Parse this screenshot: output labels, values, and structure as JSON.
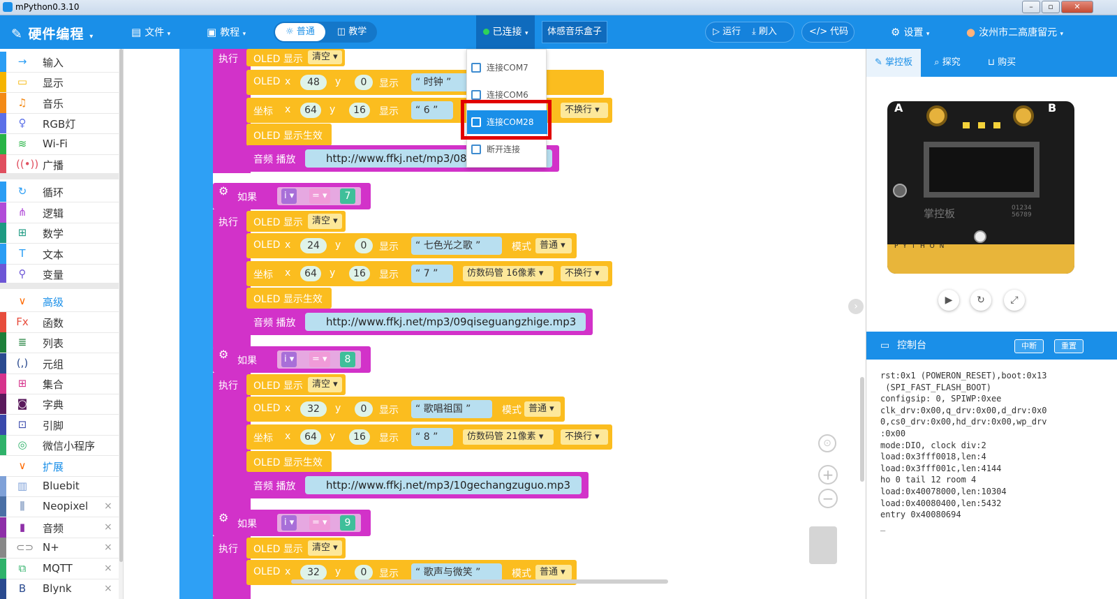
{
  "window": {
    "title": "mPython0.3.10"
  },
  "nav": {
    "logo": "硬件编程",
    "file": "文件",
    "tutorial": "教程",
    "mode_normal": "普通",
    "mode_teach": "教学",
    "connected": "已连接",
    "music_box": "体感音乐盒子",
    "run": "运行",
    "flash": "刷入",
    "code": "代码",
    "settings": "设置",
    "user": "汝州市二高唐留元"
  },
  "sidebar": {
    "items": [
      {
        "label": "输入",
        "color": "#2a9df4",
        "icon": "input-icon"
      },
      {
        "label": "显示",
        "color": "#f5b400",
        "icon": "display-icon"
      },
      {
        "label": "音乐",
        "color": "#f38a16",
        "icon": "music-icon"
      },
      {
        "label": "RGB灯",
        "color": "#5b70e8",
        "icon": "bulb-icon"
      },
      {
        "label": "Wi-Fi",
        "color": "#28b446",
        "icon": "wifi-icon"
      },
      {
        "label": "广播",
        "color": "#e04f5f",
        "icon": "broadcast-icon"
      },
      {
        "label": "循环",
        "color": "#2a9df4",
        "icon": "loop-icon"
      },
      {
        "label": "逻辑",
        "color": "#b14cd8",
        "icon": "logic-icon"
      },
      {
        "label": "数学",
        "color": "#1d9a82",
        "icon": "math-icon"
      },
      {
        "label": "文本",
        "color": "#2a9df4",
        "icon": "text-icon"
      },
      {
        "label": "变量",
        "color": "#6d56d6",
        "icon": "variable-icon"
      },
      {
        "label": "高级",
        "color": "#ff6a00",
        "icon": "chevron-down-icon"
      },
      {
        "label": "函数",
        "color": "#e74c3c",
        "icon": "function-icon"
      },
      {
        "label": "列表",
        "color": "#1d7f3a",
        "icon": "list-icon"
      },
      {
        "label": "元组",
        "color": "#2a4a8f",
        "icon": "tuple-icon"
      },
      {
        "label": "集合",
        "color": "#d6338c",
        "icon": "set-icon"
      },
      {
        "label": "字典",
        "color": "#5a1a5c",
        "icon": "dict-icon"
      },
      {
        "label": "引脚",
        "color": "#3949ab",
        "icon": "pin-icon"
      },
      {
        "label": "微信小程序",
        "color": "#2fb26a",
        "icon": "wechat-icon"
      },
      {
        "label": "扩展",
        "color": "#ff6a00",
        "icon": "chevron-down-icon"
      },
      {
        "label": "Bluebit",
        "color": "#7fa1d8",
        "icon": "bluebit-icon"
      },
      {
        "label": "Neopixel",
        "color": "#4a6fa5",
        "icon": "neopixel-icon"
      },
      {
        "label": "音频",
        "color": "#8e2fa8",
        "icon": "audio-icon"
      },
      {
        "label": "N+",
        "color": "#888",
        "icon": "nplus-icon"
      },
      {
        "label": "MQTT",
        "color": "#2fb26a",
        "icon": "mqtt-icon"
      },
      {
        "label": "Blynk",
        "color": "#2a4a8f",
        "icon": "blynk-icon"
      }
    ],
    "close_glyph": "×"
  },
  "blocks": {
    "exec": "执行",
    "if": "如果",
    "oled_show": "OLED 显示",
    "clear": "清空",
    "oled": "OLED",
    "x": "x",
    "y": "y",
    "show": "显示",
    "coord": "坐标",
    "mode": "模式",
    "normal": "普通",
    "no_wrap": "不换行",
    "oled_effect": "OLED 显示生效",
    "audio_play": "音频 播放",
    "var_i": "i",
    "eq": "=",
    "group1": {
      "x1": "48",
      "y1": "0",
      "text1": "时钟",
      "cx": "64",
      "cy": "16",
      "num": "6",
      "url": "http://www.ffkj.net/mp3/08s"
    },
    "group2": {
      "cond": "7",
      "x1": "24",
      "y1": "0",
      "text1": "七色光之歌",
      "cx": "64",
      "cy": "16",
      "num": "7",
      "font": "仿数码管 16像素",
      "url": "http://www.ffkj.net/mp3/09qiseguangzhige.mp3"
    },
    "group3": {
      "cond": "8",
      "x1": "32",
      "y1": "0",
      "text1": "歌唱祖国",
      "cx": "64",
      "cy": "16",
      "num": "8",
      "font": "仿数码管 21像素",
      "url": "http://www.ffkj.net/mp3/10gechangzuguo.mp3"
    },
    "group4": {
      "cond": "9",
      "x1": "32",
      "y1": "0",
      "text1": "歌声与微笑"
    }
  },
  "dropdown": {
    "items": [
      "连接COM7",
      "连接COM6",
      "连接COM28",
      "断开连接"
    ],
    "selected": "连接COM28"
  },
  "right": {
    "tabs": [
      "掌控板",
      "探究",
      "购买"
    ],
    "console_title": "控制台",
    "btn_break": "中断",
    "btn_reset": "重置",
    "board_a": "A",
    "board_b": "B",
    "board_brand": "掌控板",
    "board_serial": "01234\n56789",
    "board_pins": "P Y T H O N",
    "console_lines": "rst:0x1 (POWERON_RESET),boot:0x13\n (SPI_FAST_FLASH_BOOT)\nconfigsip: 0, SPIWP:0xee\nclk_drv:0x00,q_drv:0x00,d_drv:0x0\n0,cs0_drv:0x00,hd_drv:0x00,wp_drv\n:0x00\nmode:DIO, clock div:2\nload:0x3fff0018,len:4\nload:0x3fff001c,len:4144\nho 0 tail 12 room 4\nload:0x40078000,len:10304\nload:0x40080400,len:5432\nentry 0x40080694\n_"
  }
}
